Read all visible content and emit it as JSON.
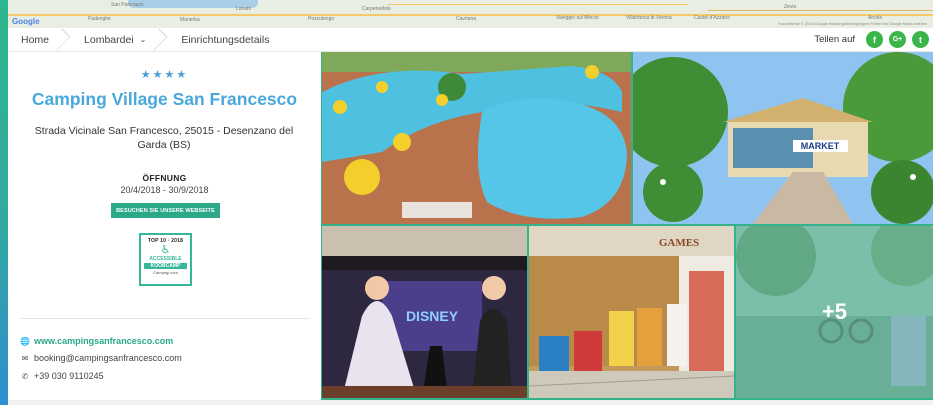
{
  "map": {
    "labels": [
      "San Pancrazio",
      "Padenghe",
      "Manerba",
      "Lonato",
      "Pozzolengo",
      "Carpenedolo",
      "Cavriana",
      "Valeggio sul Mincio",
      "Villafranca di Verona",
      "Castel d'Azzano",
      "Zevio",
      "Arcole"
    ],
    "google": "Google",
    "attribution": "Kurzbefehle  © 2018 Google  Nutzungsbedingungen  Fehler bei Google Maps melden"
  },
  "nav": {
    "home": "Home",
    "region": "Lombardei",
    "current": "Einrichtungsdetails",
    "share_label": "Teilen auf",
    "social": [
      {
        "name": "facebook",
        "glyph": "f"
      },
      {
        "name": "google-plus",
        "glyph": "G+"
      },
      {
        "name": "twitter",
        "glyph": "t"
      }
    ]
  },
  "campsite": {
    "stars": "★★★★",
    "name": "Camping Village San Francesco",
    "address": "Strada Vicinale San Francesco, 25015 - Desenzano del Garda (BS)",
    "open_label": "ÖFFNUNG",
    "open_dates": "20/4/2018 - 30/9/2018",
    "website_button": "BESUCHEN SIE UNSERE WEBSEITE",
    "badge": {
      "top": "TOP 10 · 2018",
      "mid": "ACCESSIBLE",
      "band": "KOOBCAMP",
      "foot": "Campegi.com"
    },
    "website": "www.campingsanfrancesco.com",
    "email": "booking@campingsanfrancesco.com",
    "phone": "+39 030 9110245"
  },
  "gallery": {
    "market_sign": "MARKET",
    "games_sign": "GAMES",
    "disney_sign": "DISNEY",
    "more": "+5"
  },
  "colors": {
    "accent": "#2aa888",
    "title": "#4aa8dc",
    "social": "#3ab54a"
  }
}
